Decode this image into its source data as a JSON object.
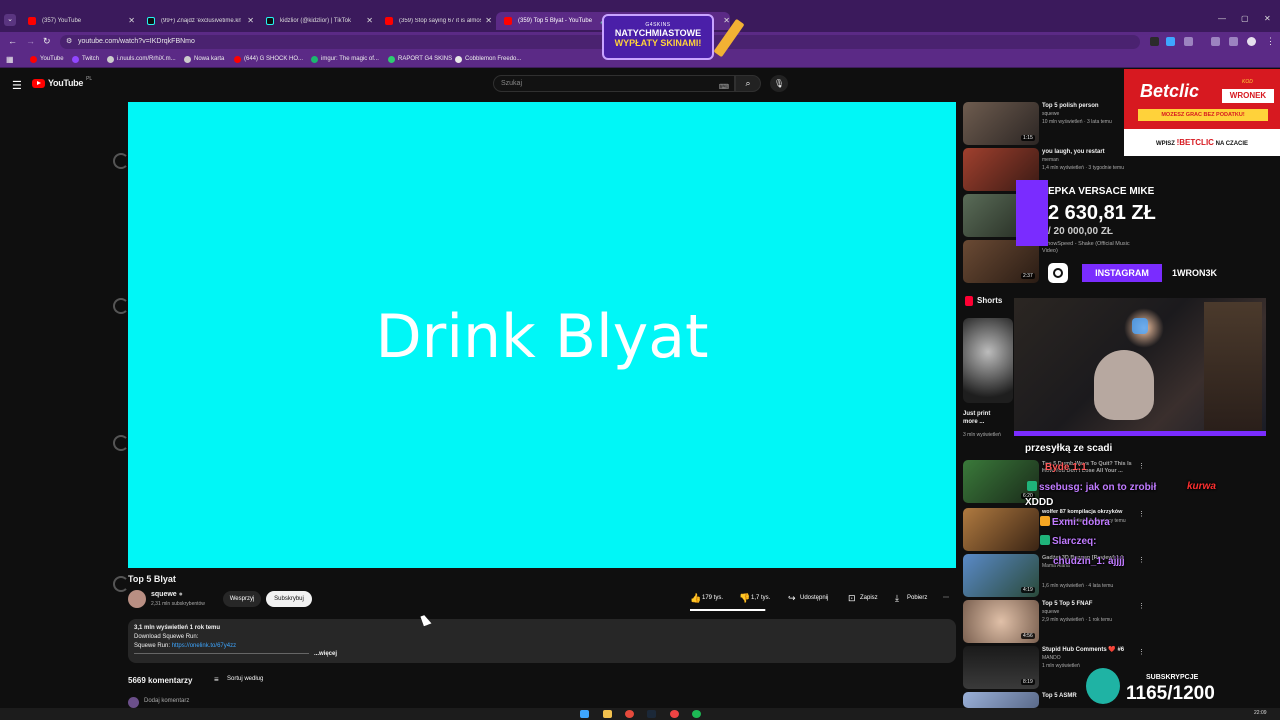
{
  "browser": {
    "tabs": [
      {
        "label": "(357) YouTube",
        "favicon_color": "#ff0000"
      },
      {
        "label": "(99+) Znajdź 'exclusivetime.krk'",
        "favicon_color": "#000000"
      },
      {
        "label": "kidzlior (@kidzlior) | TikTok",
        "favicon_color": "#000000"
      },
      {
        "label": "(359) Stop saying 67 it is almost...",
        "favicon_color": "#ff0000"
      },
      {
        "label": "(359) Top 5 Blyat - YouTube",
        "favicon_color": "#ff0000"
      }
    ],
    "url": "youtube.com/watch?v=IKDrqkFBNmo",
    "bookmarks": [
      {
        "label": "YouTube",
        "color": "#ff0000"
      },
      {
        "label": "Twitch",
        "color": "#9146ff"
      },
      {
        "label": "i.nuuls.com/RrhiX.m...",
        "color": "#cccccc"
      },
      {
        "label": "Nowa karta",
        "color": "#cccccc"
      },
      {
        "label": "(644) G SHOCK HO...",
        "color": "#ff0000"
      },
      {
        "label": "imgur: The magic of...",
        "color": "#1bb76e"
      },
      {
        "label": "RAPORT G4 SKINS",
        "color": "#2ecc71"
      },
      {
        "label": "Cobblemon Freedo...",
        "color": "#e8e8e8"
      }
    ]
  },
  "promo": {
    "brand": "G4SKINS",
    "line1": "NATYCHMIASTOWE",
    "line2": "WYPŁATY SKINAMI!"
  },
  "youtube": {
    "logo": "YouTube",
    "region": "PL",
    "search_placeholder": "Szukaj"
  },
  "video": {
    "player_text": "Drink Blyat",
    "title": "Top 5 Blyat",
    "channel": "squewe",
    "subscribers": "2,31 mln subskrybentów",
    "support_label": "Wesprzyj",
    "subscribe_label": "Subskrybuj",
    "likes": "179 tys.",
    "dislikes": "1,7 tys.",
    "like_ratio": 0.99,
    "share_label": "Udostępnij",
    "save_label": "Zapisz",
    "download_label": "Pobierz",
    "desc_meta": "3,1 mln wyświetleń  1 rok temu",
    "desc_line1": "Download Squewe Run:",
    "desc_line2_prefix": "Squewe Run: ",
    "desc_link": "https://onelink.to/67y4zz",
    "more_label": "...więcej",
    "comment_count": "5669 komentarzy",
    "sort_label": "Sortuj według",
    "add_comment": "Dodaj komentarz"
  },
  "sidebar": {
    "recs": [
      {
        "title": "Top 5 polish person",
        "channel": "squewe",
        "meta": "10 mln wyświetleń · 3 lata temu",
        "duration": "1:15",
        "color": "#7a6a5c"
      },
      {
        "title": "you laugh, you restart",
        "channel": "meman",
        "meta": "1,4 mln wyświetleń · 3 tygodnie temu",
        "duration": "",
        "color": "#8c3a2e"
      },
      {
        "title": "",
        "channel": "",
        "meta": "",
        "duration": "",
        "color": "#4a5a48"
      },
      {
        "title": "IShowSpeed - Shake (Official Music Video)",
        "channel": "",
        "meta": "",
        "duration": "2:37",
        "color": "#5a4030"
      }
    ],
    "shorts_label": "Shorts",
    "short_title": "Just print more ...",
    "short_meta": "3 mln wyświetleń",
    "recs2": [
      {
        "title": "Top 5 Dumb Ways To Quit? This Is How You Don't Lose All Your ...",
        "channel": "",
        "meta": "",
        "duration": "6:20",
        "color": "#3a6b3a"
      },
      {
        "title": "wolfer 87 kompilacja okrzyków",
        "channel": "",
        "meta": "491 tys. wyświetleń · 5 miesięcy temu",
        "duration": "",
        "color": "#8a5a30"
      },
      {
        "title": "Gadżet 3D Buzgan [Review] 1.1",
        "channel": "Mama Alana",
        "meta": "1,6 mln wyświetleń · 4 lata temu",
        "duration": "4:19",
        "color": "#4a7ab5"
      },
      {
        "title": "Top 5 Top 5 FNAF",
        "channel": "squewe",
        "meta": "2,9 mln wyświetleń · 1 rok temu",
        "duration": "4:56",
        "color": "#c8a890"
      },
      {
        "title": "Stupid Hub Comments ❤️ #6",
        "channel": "MANDO",
        "meta": "1 mln wyświetleń",
        "duration": "8:19",
        "color": "#2a2a2a"
      },
      {
        "title": "Top 5 ASMR",
        "channel": "",
        "meta": "",
        "duration": "",
        "color": "#8aa0c8"
      }
    ]
  },
  "overlay": {
    "betclic_logo": "Betclic",
    "betclic_code_label": "KOD",
    "betclic_code": "WRONEK",
    "betclic_bonus": "MOZESZ GRAC BEZ PODATKU!",
    "betclic_wpisz": "WPISZ",
    "betclic_wpisz_brand": "!BETCLIC",
    "betclic_wpisz_suffix": "NA CZACIE",
    "donation_name": "EPKA VERSACE MIKE",
    "donation_amount": "2 630,81 ZŁ",
    "donation_goal": "/ 20 000,00 ZŁ",
    "social_tag": "INSTAGRAM",
    "social_handle": "1WRON3K",
    "chat": [
      {
        "text": "przesyłką ze scadi"
      },
      {
        "text": "Byde 1:1"
      },
      {
        "text": "ssebusg: jak on to zrobił"
      },
      {
        "text": "kurwa"
      },
      {
        "text": "XDDD"
      },
      {
        "text": "Exmi: dobra"
      },
      {
        "text": "Slarczeq:"
      },
      {
        "text": "chudzin_1: ajjjj"
      }
    ],
    "subs_label": "SUBSKRYPCJE",
    "subs_value": "1165/1200"
  },
  "taskbar": {
    "clock": "22:09"
  }
}
